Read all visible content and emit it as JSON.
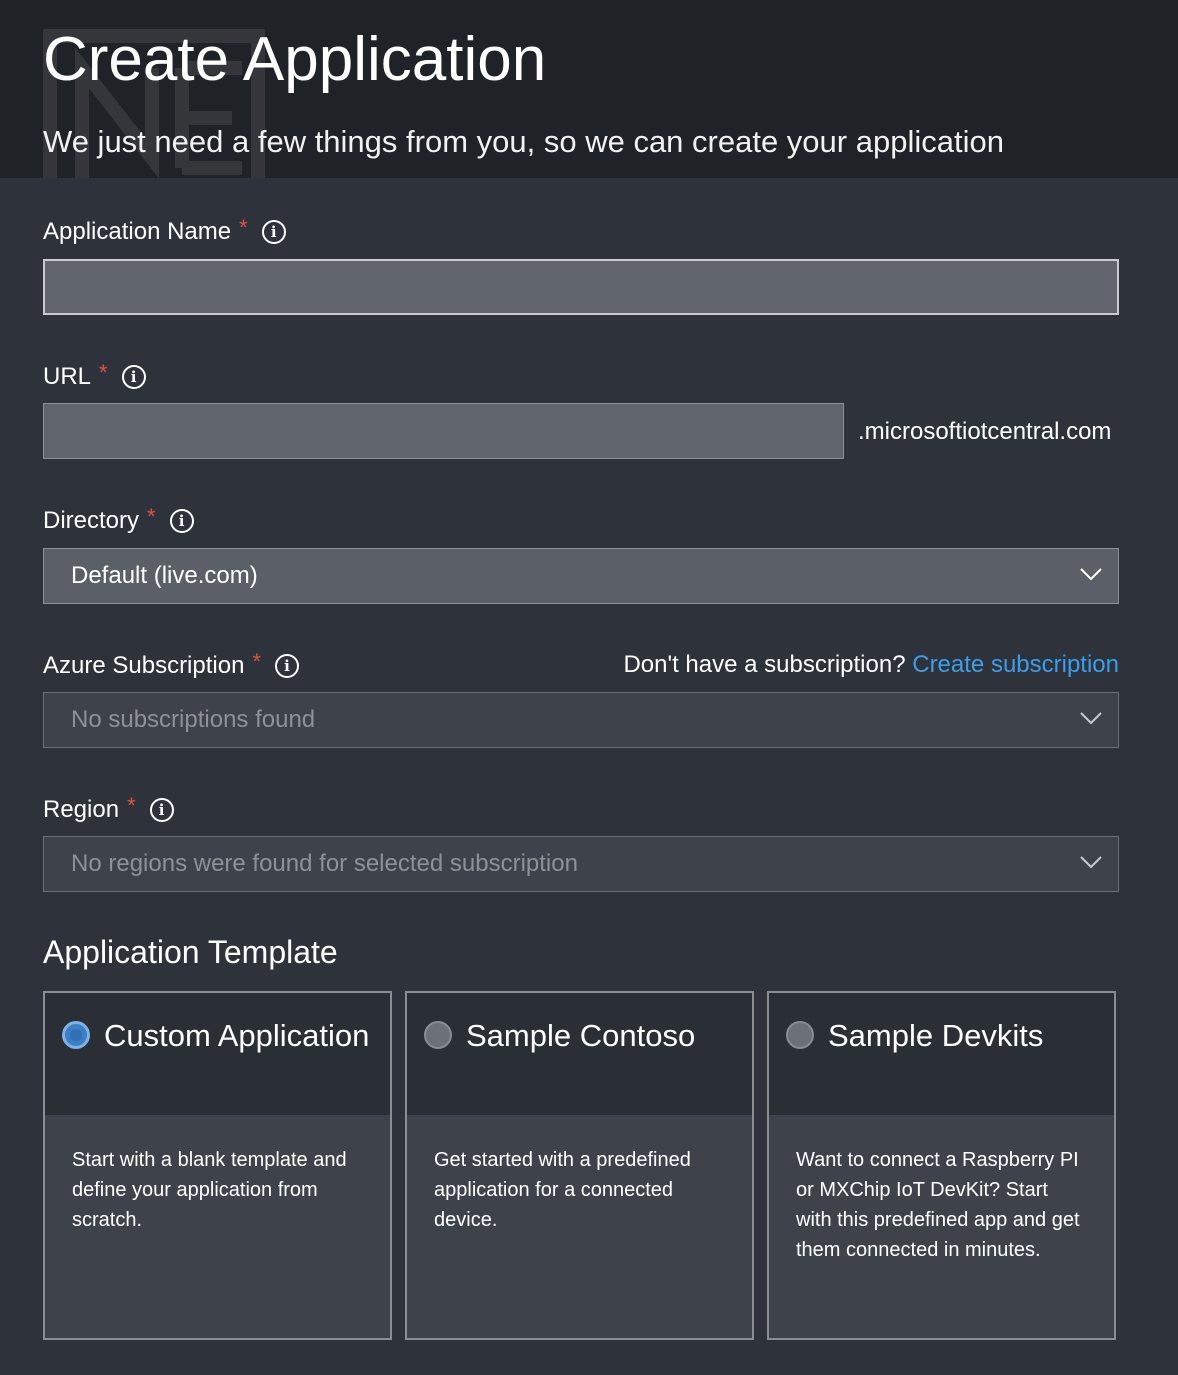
{
  "header": {
    "title": "Create Application",
    "subtitle": "We just need a few things from you, so we can create your application"
  },
  "fields": {
    "app_name": {
      "label": "Application Name",
      "required": "*",
      "value": ""
    },
    "url": {
      "label": "URL",
      "required": "*",
      "value": "",
      "suffix": ".microsoftiotcentral.com"
    },
    "directory": {
      "label": "Directory",
      "required": "*",
      "value": "Default (live.com)"
    },
    "subscription": {
      "label": "Azure Subscription",
      "required": "*",
      "value": "No subscriptions found",
      "no_sub_text": "Don't have a subscription?",
      "create_link": "Create subscription"
    },
    "region": {
      "label": "Region",
      "required": "*",
      "value": "No regions were found for selected subscription"
    }
  },
  "template": {
    "title": "Application Template",
    "cards": [
      {
        "title": "Custom Application",
        "description": "Start with a blank template and define your application from scratch.",
        "selected": true
      },
      {
        "title": "Sample Contoso",
        "description": "Get started with a predefined application for a connected device.",
        "selected": false
      },
      {
        "title": "Sample Devkits",
        "description": "Want to connect a Raspberry PI or MXChip IoT DevKit? Start with this predefined app and get them connected in minutes.",
        "selected": false
      }
    ]
  },
  "icons": {
    "info": "info-icon",
    "dropdown": "chevron-down-icon"
  },
  "colors": {
    "accent": "#3a9ee9",
    "required": "#e0533f",
    "header_bg": "#1f2226",
    "page_bg": "#2e333b"
  }
}
